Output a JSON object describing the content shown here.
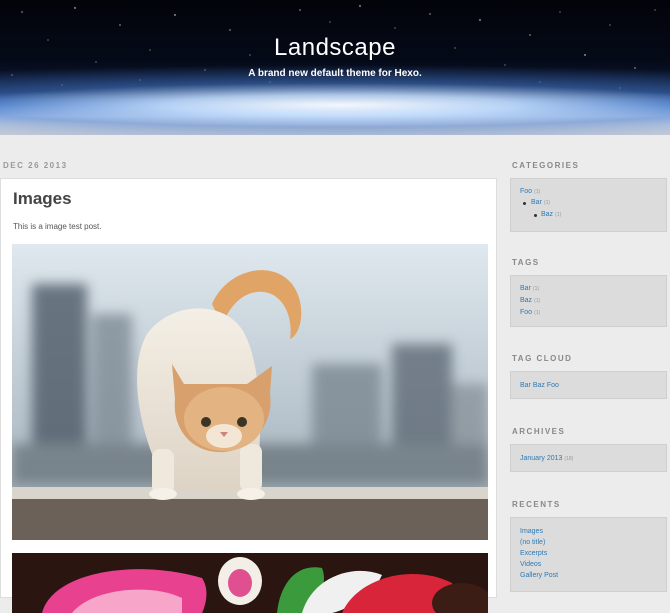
{
  "header": {
    "title": "Landscape",
    "subtitle": "A brand new default theme for Hexo."
  },
  "post": {
    "date": "DEC 26 2013",
    "title": "Images",
    "text": "This is a image test post."
  },
  "sidebar": {
    "categories": {
      "title": "CATEGORIES",
      "items": [
        {
          "label": "Foo",
          "count": "(1)"
        },
        {
          "label": "Bar",
          "count": "(1)"
        },
        {
          "label": "Baz",
          "count": "(1)"
        }
      ]
    },
    "tags": {
      "title": "TAGS",
      "items": [
        {
          "label": "Bar",
          "count": "(1)"
        },
        {
          "label": "Baz",
          "count": "(1)"
        },
        {
          "label": "Foo",
          "count": "(1)"
        }
      ]
    },
    "tag_cloud": {
      "title": "TAG CLOUD",
      "items": [
        "Bar",
        "Baz",
        "Foo"
      ]
    },
    "archives": {
      "title": "ARCHIVES",
      "items": [
        {
          "label": "January 2013",
          "count": "(18)"
        }
      ]
    },
    "recents": {
      "title": "RECENTS",
      "items": [
        "Images",
        "(no title)",
        "Excerpts",
        "Videos",
        "Gallery Post"
      ]
    }
  },
  "colors": {
    "link": "#2d7ab5",
    "page_background": "#ececec",
    "widget_background": "#dcdcdc"
  }
}
